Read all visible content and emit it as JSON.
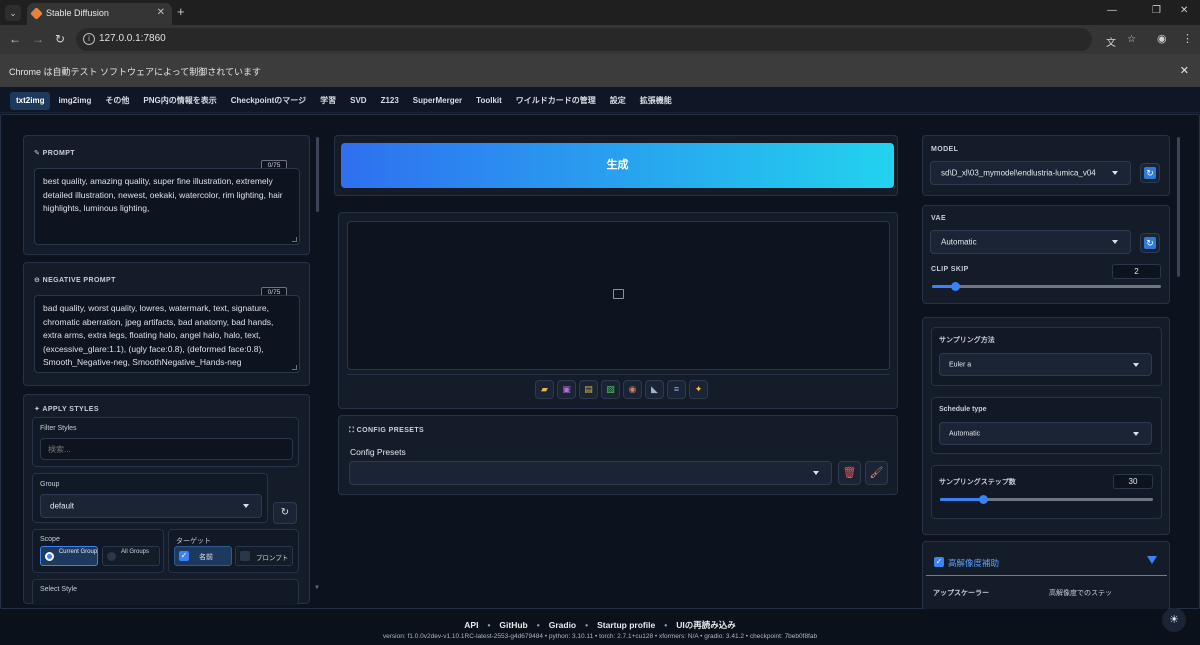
{
  "browser": {
    "tab_title": "Stable Diffusion",
    "url": "127.0.0.1:7860",
    "infobar_text": "Chrome は自動テスト ソフトウェアによって制御されています"
  },
  "app_tabs": [
    "txt2img",
    "img2img",
    "その他",
    "PNG内の情報を表示",
    "Checkpointのマージ",
    "学習",
    "SVD",
    "Z123",
    "SuperMerger",
    "Toolkit",
    "ワイルドカードの管理",
    "設定",
    "拡張機能"
  ],
  "prompt": {
    "header": "PROMPT",
    "counter": "0/75",
    "text": "best quality, amazing quality, super fine illustration, extremely detailed illustration, newest, oekaki, watercolor, rim lighting, hair highlights, luminous lighting,"
  },
  "negative_prompt": {
    "header": "NEGATIVE PROMPT",
    "counter": "0/75",
    "text": "bad quality, worst quality, lowres, watermark, text, signature, chromatic aberration, jpeg artifacts, bad anatomy, bad hands, extra arms, extra legs, floating halo, angel halo, halo, text, (excessive_glare:1.1), (ugly face:0.8), (deformed face:0.8), Smooth_Negative-neg, SmoothNegative_Hands-neg"
  },
  "styles": {
    "header": "APPLY STYLES",
    "filter_label": "Filter Styles",
    "filter_placeholder": "検索...",
    "group_label": "Group",
    "group_value": "default",
    "scope_label": "Scope",
    "scope_current": "Current Group",
    "scope_all": "All Groups",
    "target_label": "ターゲット",
    "target_name": "名前",
    "target_prompt": "プロンプト",
    "select_style_label": "Select Style"
  },
  "generate_label": "生成",
  "config_presets": {
    "header": "CONFIG PRESETS",
    "label": "Config Presets"
  },
  "model": {
    "header": "MODEL",
    "value": "sd\\D_xl\\03_mymodel\\endlustria-lumica_v04"
  },
  "vae": {
    "header": "VAE",
    "value": "Automatic",
    "clip_skip_label": "CLIP SKIP",
    "clip_skip_value": "2",
    "clip_skip_fraction": 0.1
  },
  "sampler": {
    "method_label": "サンプリング方法",
    "method_value": "Euler a",
    "schedule_label": "Schedule type",
    "schedule_value": "Automatic",
    "steps_label": "サンプリングステップ数",
    "steps_value": "30",
    "steps_fraction": 0.2
  },
  "hires": {
    "label": "高解像度補助",
    "upscaler_label": "アップスケーラー",
    "hires_steps_label": "高解像度でのステッ"
  },
  "footer": {
    "links": [
      "API",
      "GitHub",
      "Gradio",
      "Startup profile",
      "UIの再読み込み"
    ],
    "version": "version: f1.0.0v2dev-v1.10.1RC-latest-2553-g4d679484  •  python: 3.10.11  •  torch: 2.7.1+cu128  •  xformers: N/A  •  gradio: 3.41.2  •  checkpoint: 7beb0f8fab"
  },
  "colors": {
    "accent": "#3b82f6",
    "generate_start": "#2f6ff0",
    "generate_end": "#22d3ee",
    "background": "#0b111b"
  }
}
